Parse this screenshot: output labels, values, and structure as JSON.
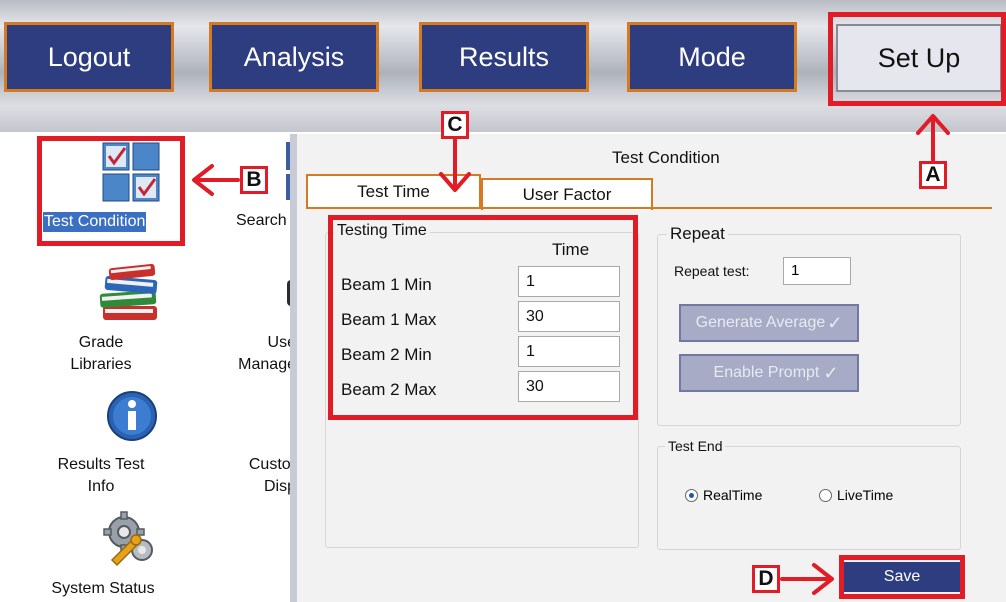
{
  "nav": {
    "logout": "Logout",
    "analysis": "Analysis",
    "results": "Results",
    "mode": "Mode",
    "setup": "Set Up"
  },
  "sidebar": {
    "test_condition": "Test Condition",
    "search": "Search",
    "grade_libraries_line1": "Grade",
    "grade_libraries_line2": "Libraries",
    "user_mgmt_line1": "Use",
    "user_mgmt_line2": "Manage",
    "results_info_line1": "Results Test",
    "results_info_line2": "Info",
    "custom_line1": "Custor",
    "custom_line2": "Disp",
    "system_status": "System Status"
  },
  "panel": {
    "title": "Test Condition",
    "tabs": [
      "Test Time",
      "User Factor"
    ]
  },
  "testing_time": {
    "legend": "Testing Time",
    "column_header": "Time",
    "rows": [
      {
        "label": "Beam 1 Min",
        "value": "1"
      },
      {
        "label": "Beam 1 Max",
        "value": "30"
      },
      {
        "label": "Beam 2 Min",
        "value": "1"
      },
      {
        "label": "Beam 2 Max",
        "value": "30"
      }
    ]
  },
  "repeat": {
    "legend": "Repeat",
    "repeat_label": "Repeat test:",
    "repeat_value": "1",
    "generate_average": "Generate Average",
    "enable_prompt": "Enable Prompt"
  },
  "test_end": {
    "legend": "Test End",
    "options": [
      "RealTime",
      "LiveTime"
    ],
    "selected": "RealTime"
  },
  "save_label": "Save",
  "annotations": {
    "a": "A",
    "b": "B",
    "c": "C",
    "d": "D"
  },
  "colors": {
    "nav_bg": "#2e3d7f",
    "nav_border": "#d67a1f",
    "callout_red": "#e11c26",
    "save_bg": "#2e3d7f"
  }
}
